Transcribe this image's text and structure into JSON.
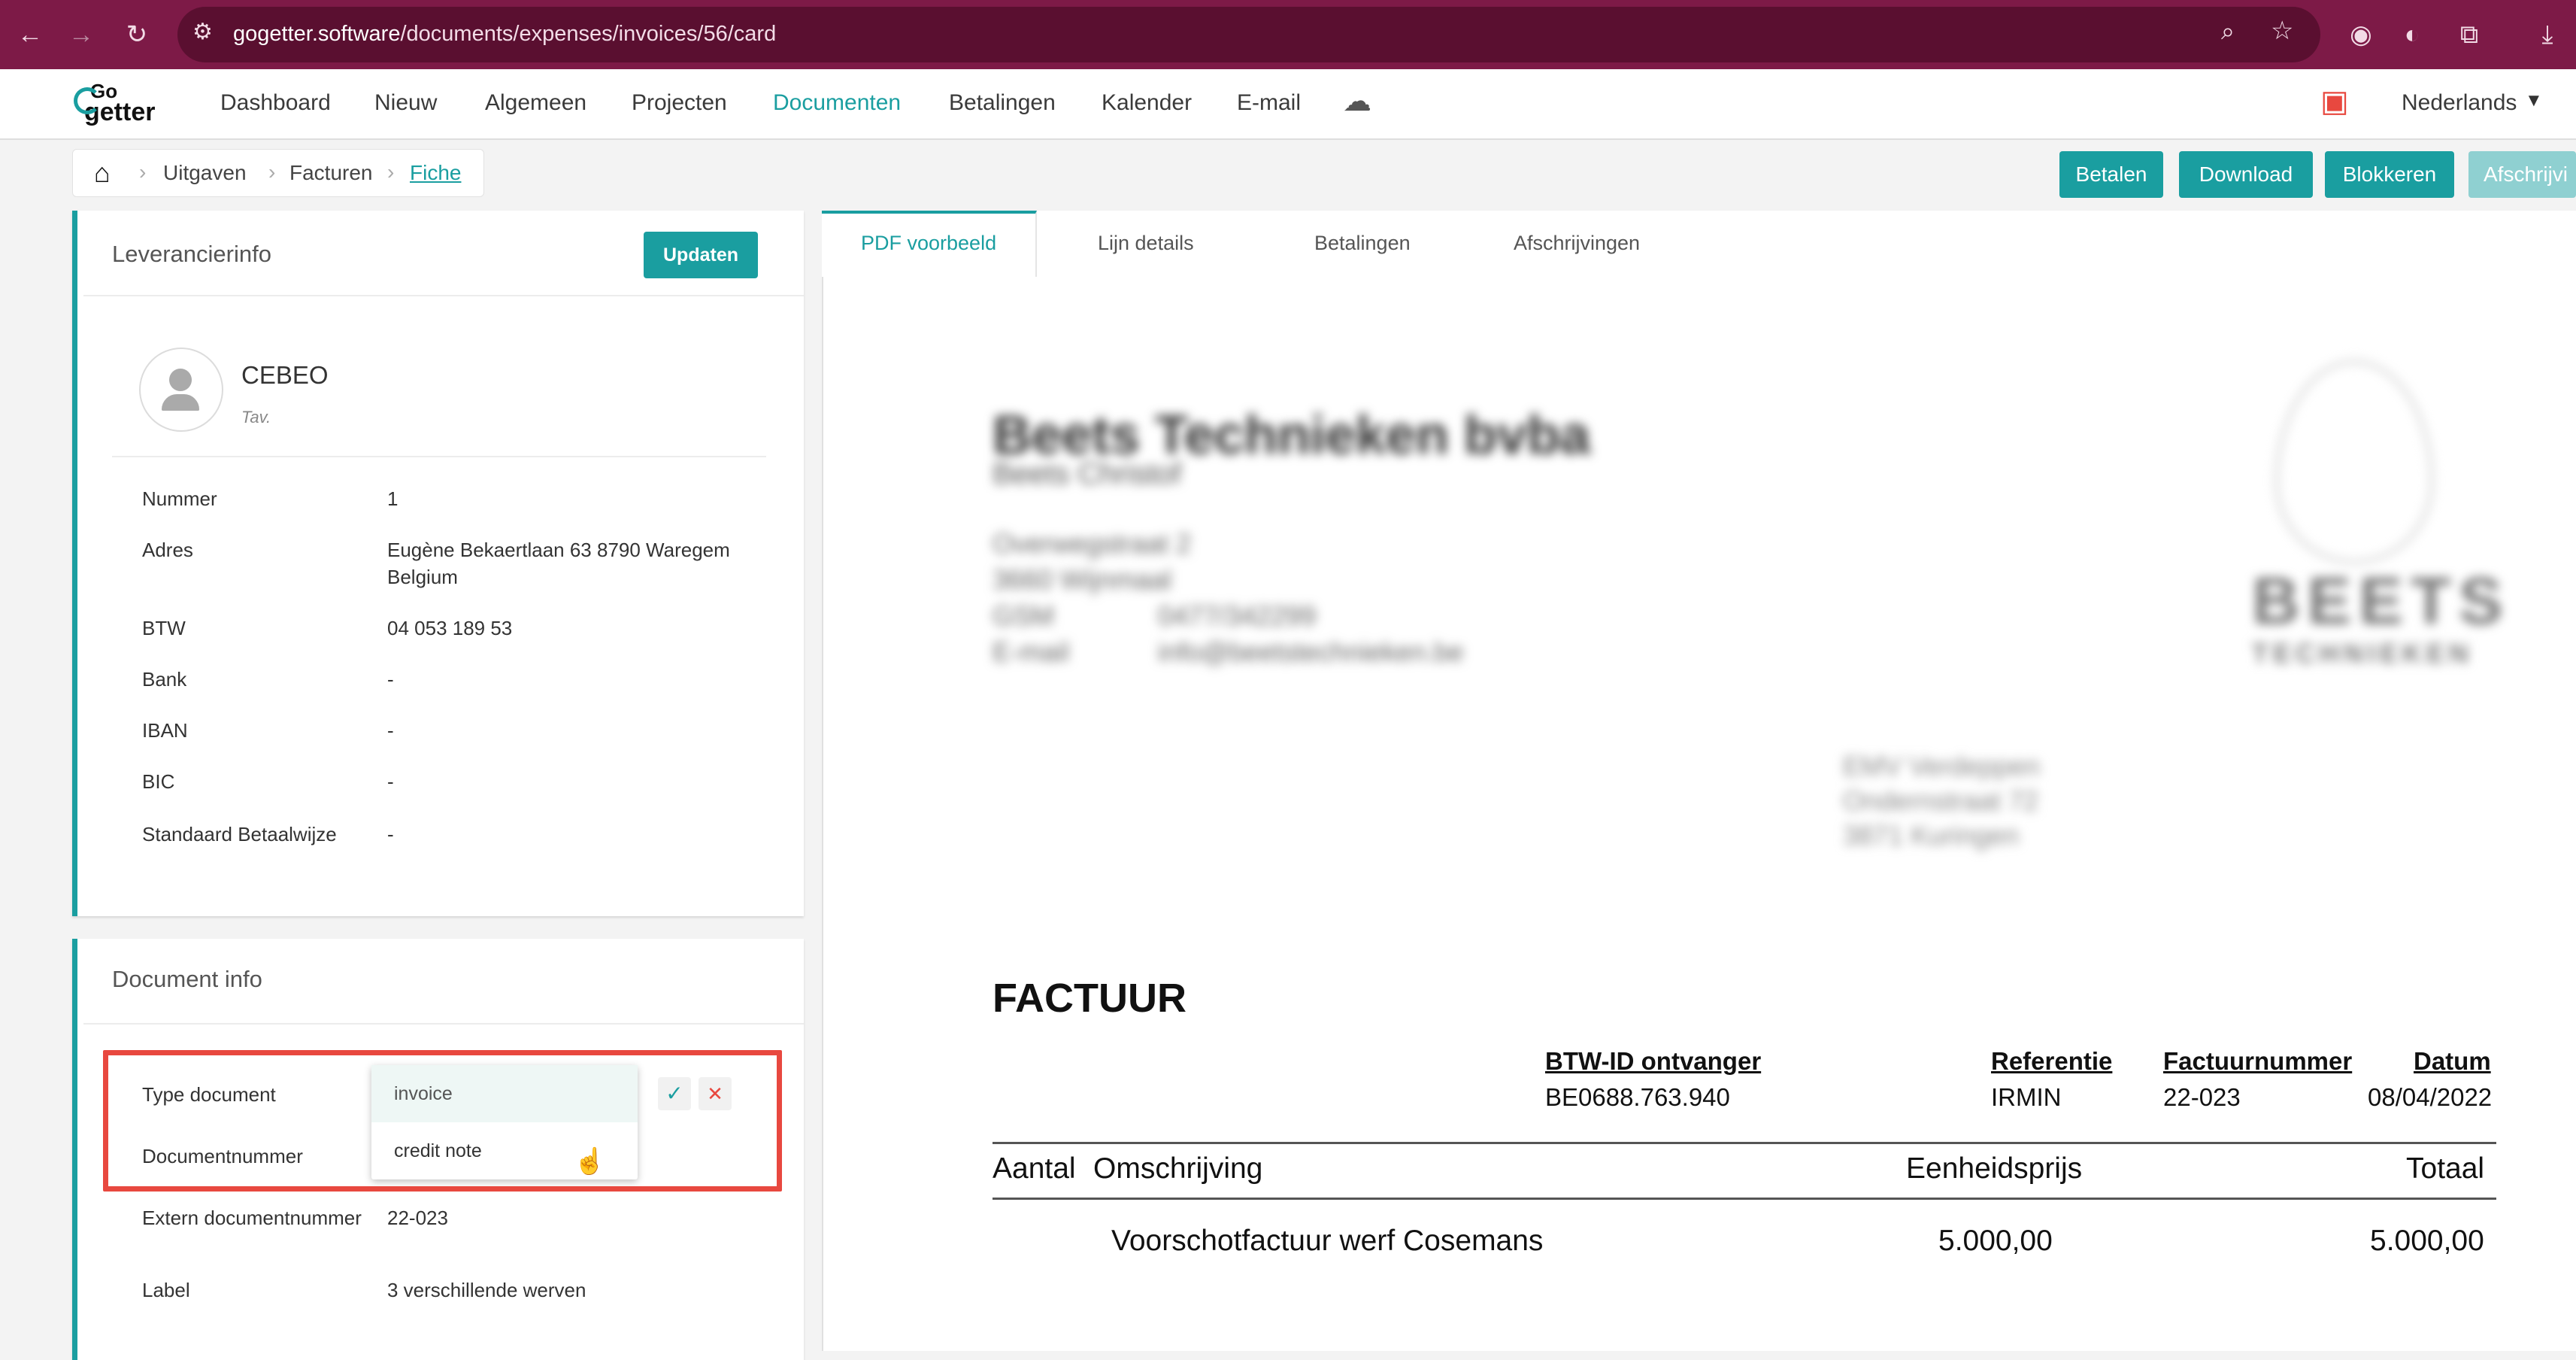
{
  "browser": {
    "url_host": "gogetter.software",
    "url_path": "/documents/expenses/invoices/56/card"
  },
  "app": {
    "logo_top": "Go",
    "logo_bottom": "getter",
    "nav": [
      "Dashboard",
      "Nieuw",
      "Algemeen",
      "Projecten",
      "Documenten",
      "Betalingen",
      "Kalender",
      "E-mail"
    ],
    "active_nav": "Documenten",
    "language": "Nederlands"
  },
  "breadcrumb": [
    "Uitgaven",
    "Facturen",
    "Fiche"
  ],
  "actions": [
    "Betalen",
    "Download",
    "Blokkeren",
    "Afschrijvi"
  ],
  "supplier_card": {
    "title": "Leverancierinfo",
    "update_label": "Updaten",
    "name": "CEBEO",
    "subtitle": "Tav.",
    "fields": [
      {
        "label": "Nummer",
        "value": "1"
      },
      {
        "label": "Adres",
        "value": "Eugène Bekaertlaan 63 8790 Waregem",
        "value2": "Belgium"
      },
      {
        "label": "BTW",
        "value": "04 053 189 53"
      },
      {
        "label": "Bank",
        "value": "-"
      },
      {
        "label": "IBAN",
        "value": "-"
      },
      {
        "label": "BIC",
        "value": "-"
      },
      {
        "label": "Standaard Betaalwijze",
        "value": "-"
      }
    ]
  },
  "document_card": {
    "title": "Document info",
    "type_label": "Type document",
    "type_options": [
      "invoice",
      "credit note"
    ],
    "docnum_label": "Documentnummer",
    "extern_label": "Extern documentnummer",
    "extern_value": "22-023",
    "label_label": "Label",
    "label_value": "3 verschillende werven"
  },
  "tabs": [
    "PDF voorbeeld",
    "Lijn details",
    "Betalingen",
    "Afschrijvingen"
  ],
  "active_tab": "PDF voorbeeld",
  "pdf": {
    "company": "Beets Technieken bvba",
    "contact": "Beets Christof",
    "addr1": "Overwegstraat 2",
    "addr2": "3660 Wijnmaal",
    "gsm_label": "GSM",
    "gsm": "0477/342299",
    "email_label": "E-mail",
    "email": "info@beetstechnieken.be",
    "logo_text": "BEETS",
    "logo_sub": "TECHNIEKEN",
    "recipient1": "EMV Verdeppen",
    "recipient2": "Ondernstraat 72",
    "recipient3": "3871 Kuringen",
    "title": "FACTUUR",
    "headers": [
      "BTW-ID ontvanger",
      "Referentie",
      "Factuurnummer",
      "Datum"
    ],
    "values": [
      "BE0688.763.940",
      "IRMIN",
      "22-023",
      "08/04/2022"
    ],
    "col_aantal": "Aantal",
    "col_omschrijving": "Omschrijving",
    "col_eenheid": "Eenheidsprijs",
    "col_totaal": "Totaal",
    "line_desc": "Voorschotfactuur werf Cosemans",
    "line_price": "5.000,00",
    "line_total": "5.000,00"
  },
  "colors": {
    "accent": "#1a9ea0",
    "chrome": "#7d1a47",
    "highlight": "#e8483f"
  }
}
